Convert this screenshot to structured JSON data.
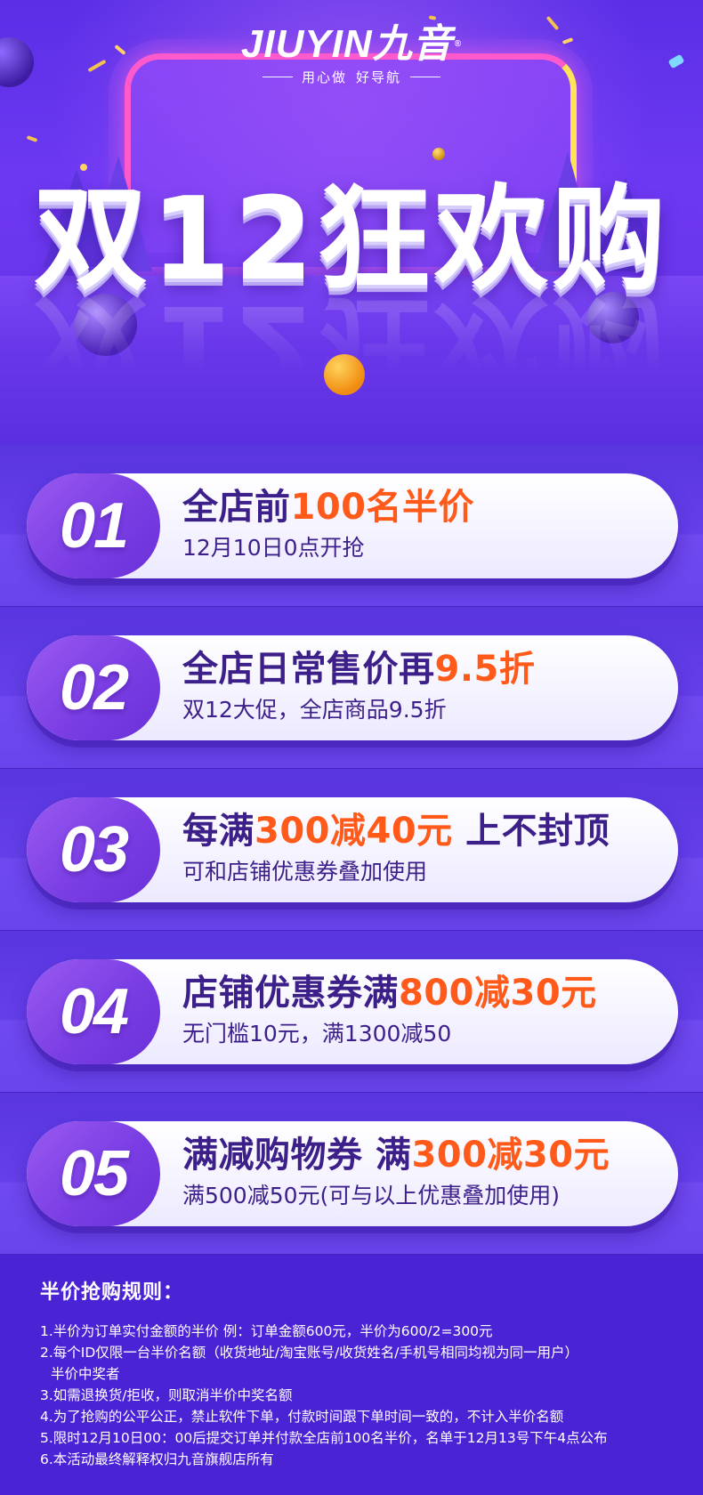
{
  "brand": {
    "logo_text": "JIUYIN九音",
    "registered_mark": "®",
    "tagline_left": "用心做",
    "tagline_right": "好导航"
  },
  "hero": {
    "title": "双12狂欢购"
  },
  "colors": {
    "background": "#4b25d6",
    "card": "#ffffff",
    "number_badge": "#8a4ae8",
    "title_text": "#3d1f8a",
    "highlight": "#ff5a1a",
    "frame_pink": "#ff5acb",
    "frame_yellow": "#ffe45a"
  },
  "deals": [
    {
      "number": "01",
      "title_main": "全店前",
      "title_highlight": "100名半价",
      "title_tail": "",
      "subtitle": "12月10日0点开抢"
    },
    {
      "number": "02",
      "title_main": "全店日常售价再",
      "title_highlight": "9.5折",
      "title_tail": "",
      "subtitle": "双12大促，全店商品9.5折"
    },
    {
      "number": "03",
      "title_main": "每满",
      "title_highlight": "300减40元",
      "title_tail": " 上不封顶",
      "subtitle": "可和店铺优惠券叠加使用"
    },
    {
      "number": "04",
      "title_main": "店铺优惠券满",
      "title_highlight": "800减30元",
      "title_tail": "",
      "subtitle": "无门槛10元，满1300减50"
    },
    {
      "number": "05",
      "title_main": "满减购物券 满",
      "title_highlight": "300减30元",
      "title_tail": "",
      "subtitle": "满500减50元(可与以上优惠叠加使用)"
    }
  ],
  "rules": {
    "title": "半价抢购规则：",
    "items": [
      "1.半价为订单实付金额的半价 例：订单金额600元，半价为600/2=300元",
      "2.每个ID仅限一台半价名额（收货地址/淘宝账号/收货姓名/手机号相同均视为同一用户）",
      "半价中奖者",
      "3.如需退换货/拒收，则取消半价中奖名额",
      "4.为了抢购的公平公正，禁止软件下单，付款时间跟下单时间一致的，不计入半价名额",
      "5.限时12月10日00：00后提交订单并付款全店前100名半价，名单于12月13号下午4点公布",
      "6.本活动最终解释权归九音旗舰店所有"
    ]
  }
}
